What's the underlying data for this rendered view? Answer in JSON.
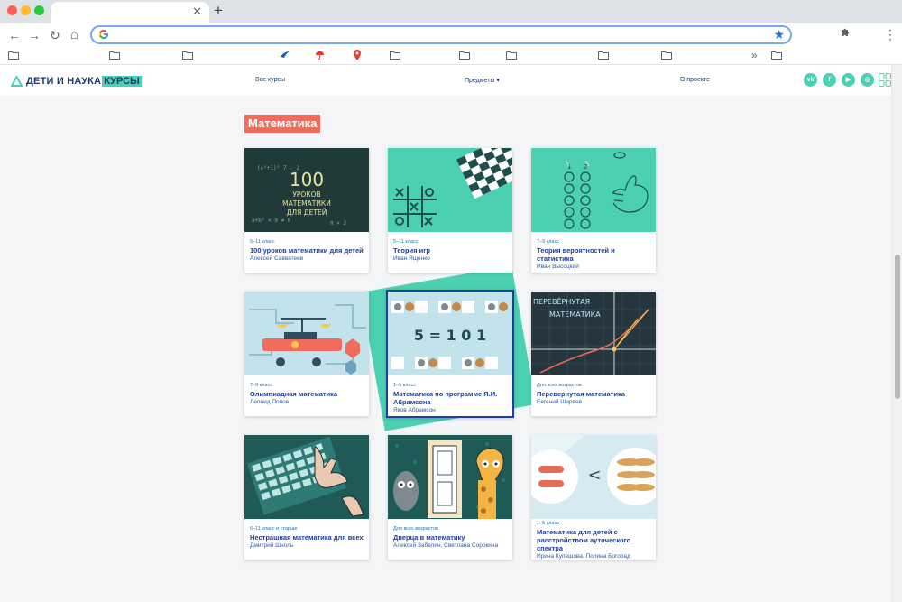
{
  "browser": {
    "tab_close": "✕",
    "new_tab": "+",
    "back": "←",
    "forward": "→",
    "reload": "↻",
    "home": "⌂",
    "omnibox_icon": "google-icon",
    "bookmark_star": "★",
    "extensions_icon": "puzzle-icon",
    "menu_icon": "⋮",
    "bookmarks_more": "»",
    "colors": {
      "chrome": "#dee1e6",
      "omnibox_border": "#7aa7f4",
      "star": "#1a73e8"
    }
  },
  "site": {
    "logo_text": "ДЕТИ И НАУКА",
    "logo_highlight": "КУРСЫ",
    "nav": {
      "all_courses": "Все курсы",
      "subjects": "Предметы ▾",
      "about": "О проекте"
    },
    "social": [
      "vk",
      "f",
      "yt",
      "ig",
      "grid"
    ],
    "colors": {
      "accent": "#4bd1b2",
      "title_bg": "#f26c5b",
      "link": "#1d3f9a"
    }
  },
  "section": {
    "title": "Математика"
  },
  "cards": [
    {
      "grade": "5–11 класс",
      "title": "100 уроков математики для детей",
      "author": "Алексей Савватеев",
      "thumb_text": "100 УРОКОВ МАТЕМАТИКИ ДЛЯ ДЕТЕЙ"
    },
    {
      "grade": "5–11 класс",
      "title": "Теория игр",
      "author": "Иван Ященко"
    },
    {
      "grade": "7–9 класс",
      "title": "Теория вероятностей и статистика",
      "author": "Иван Высоцкий"
    },
    {
      "grade": "7–9 класс",
      "title": "Олимпиадная математика",
      "author": "Леонид Попов"
    },
    {
      "grade": "1–5 класс",
      "title": "Математика по программе Я.И. Абрамсона",
      "author": "Яков Абрамсон",
      "thumb_text": "5 = 1 0 1"
    },
    {
      "grade": "Для всех возрастов",
      "title": "Перевернутая математика",
      "author": "Евгений Ширяев",
      "thumb_text": "ПЕРЕВЁРНУТАЯ МАТЕМАТИКА"
    },
    {
      "grade": "6–11 класс и старше",
      "title": "Нестрашная математика для всех",
      "author": "Дмитрий Шноль"
    },
    {
      "grade": "Для всех возрастов",
      "title": "Дверца в математику",
      "author": "Алексей Забелин, Светлана Сорокина"
    },
    {
      "grade": "1–5 класс",
      "title": "Математика для детей с расстройством аутического спектра",
      "author": "Ирина Купешова, Полина Богорад"
    }
  ]
}
